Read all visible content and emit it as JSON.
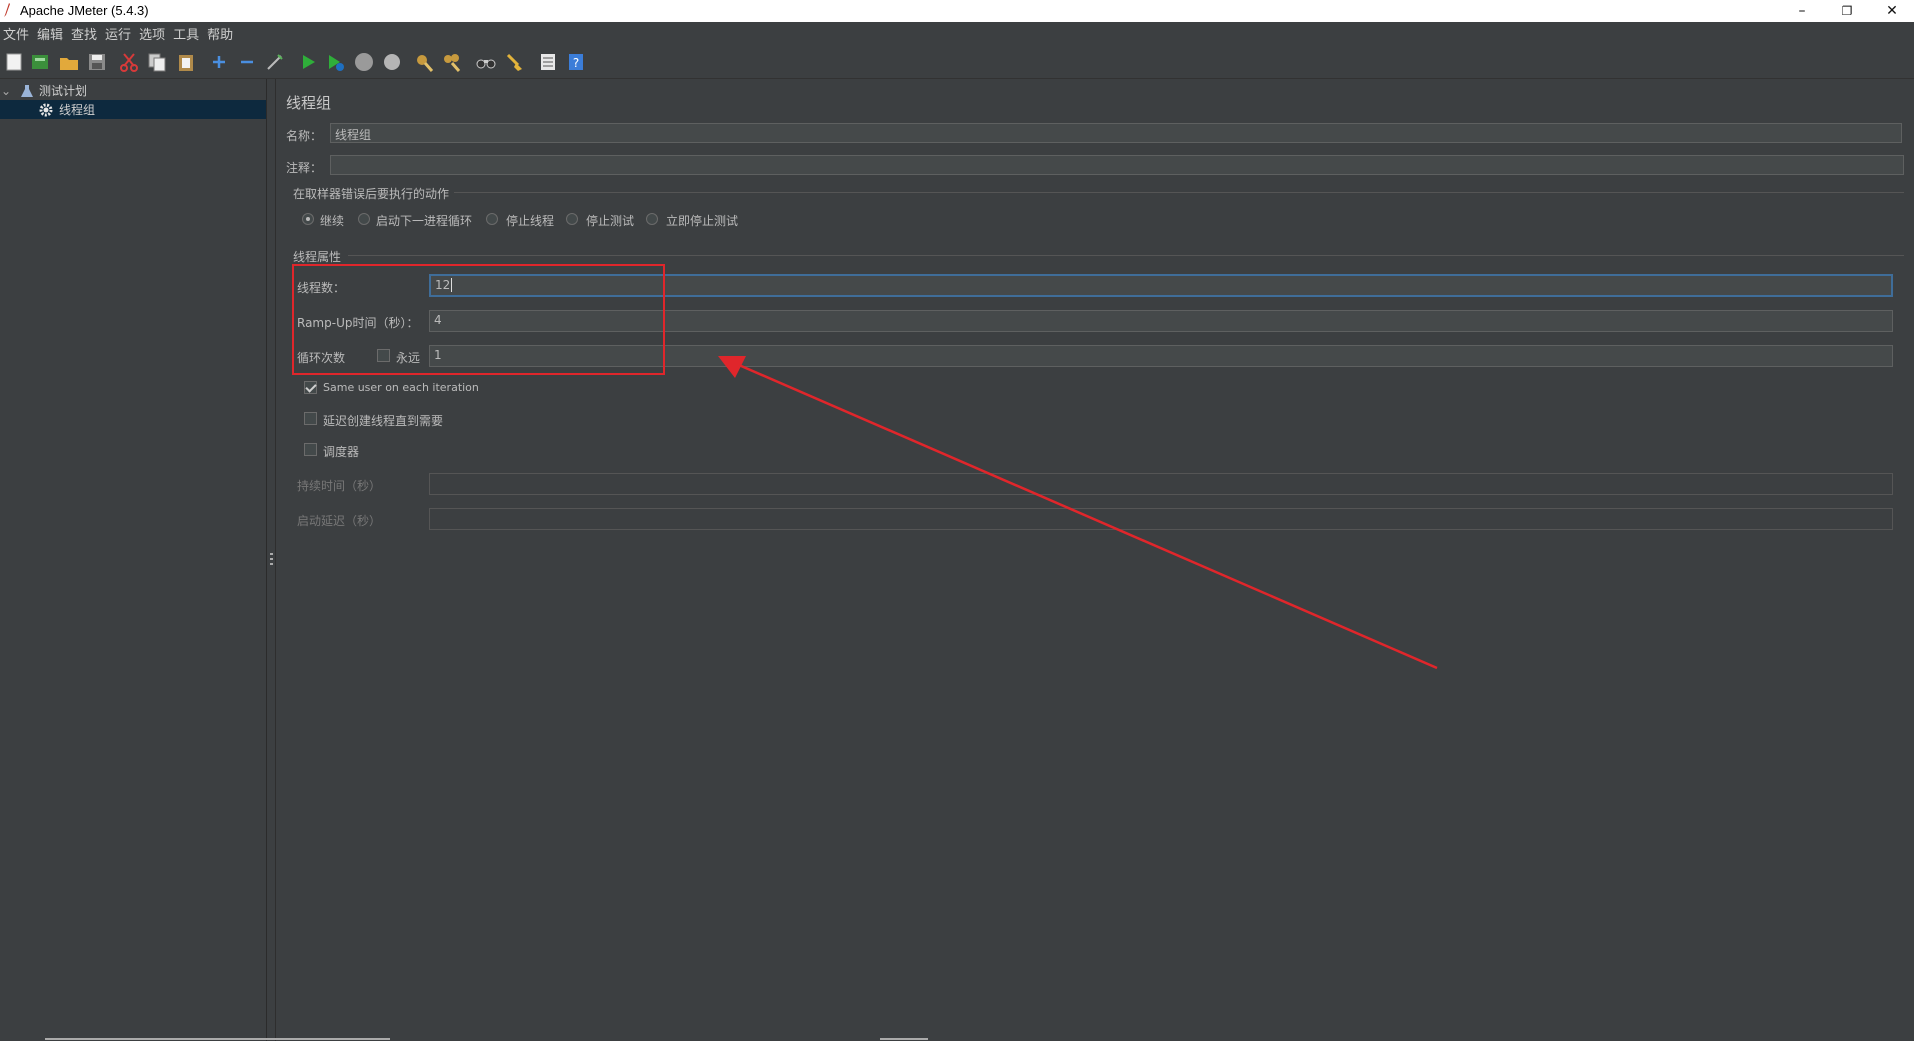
{
  "window": {
    "title": "Apache JMeter (5.4.3)",
    "minimize": "–",
    "restore": "❐",
    "close": "✕"
  },
  "menu": [
    "文件",
    "编辑",
    "查找",
    "运行",
    "选项",
    "工具",
    "帮助"
  ],
  "tree": {
    "root": {
      "label": "测试计划",
      "expander": "⌄"
    },
    "child": {
      "label": "线程组"
    }
  },
  "panel": {
    "title": "线程组",
    "name_label": "名称：",
    "name_value": "线程组",
    "comment_label": "注释：",
    "comment_value": "",
    "error_action": {
      "heading": "在取样器错误后要执行的动作",
      "options": [
        "继续",
        "启动下一进程循环",
        "停止线程",
        "停止测试",
        "立即停止测试"
      ],
      "selected_index": 0
    },
    "thread_props": {
      "heading": "线程属性",
      "threads_label": "线程数：",
      "threads_value": "12",
      "rampup_label": "Ramp-Up时间（秒）：",
      "rampup_value": "4",
      "loop_label": "循环次数",
      "forever_label": "永远",
      "forever_checked": false,
      "loop_value": "1"
    },
    "same_user": {
      "label": "Same user on each iteration",
      "checked": true
    },
    "delay_create": {
      "label": "延迟创建线程直到需要",
      "checked": false
    },
    "scheduler": {
      "label": "调度器",
      "checked": false
    },
    "duration_label": "持续时间（秒）",
    "duration_value": "",
    "startup_delay_label": "启动延迟（秒）",
    "startup_delay_value": ""
  },
  "annotation": {
    "color": "#e0262b"
  },
  "colors": {
    "background": "#3c3f41",
    "selection": "#0d293e",
    "focus_border": "#3f6d99"
  }
}
